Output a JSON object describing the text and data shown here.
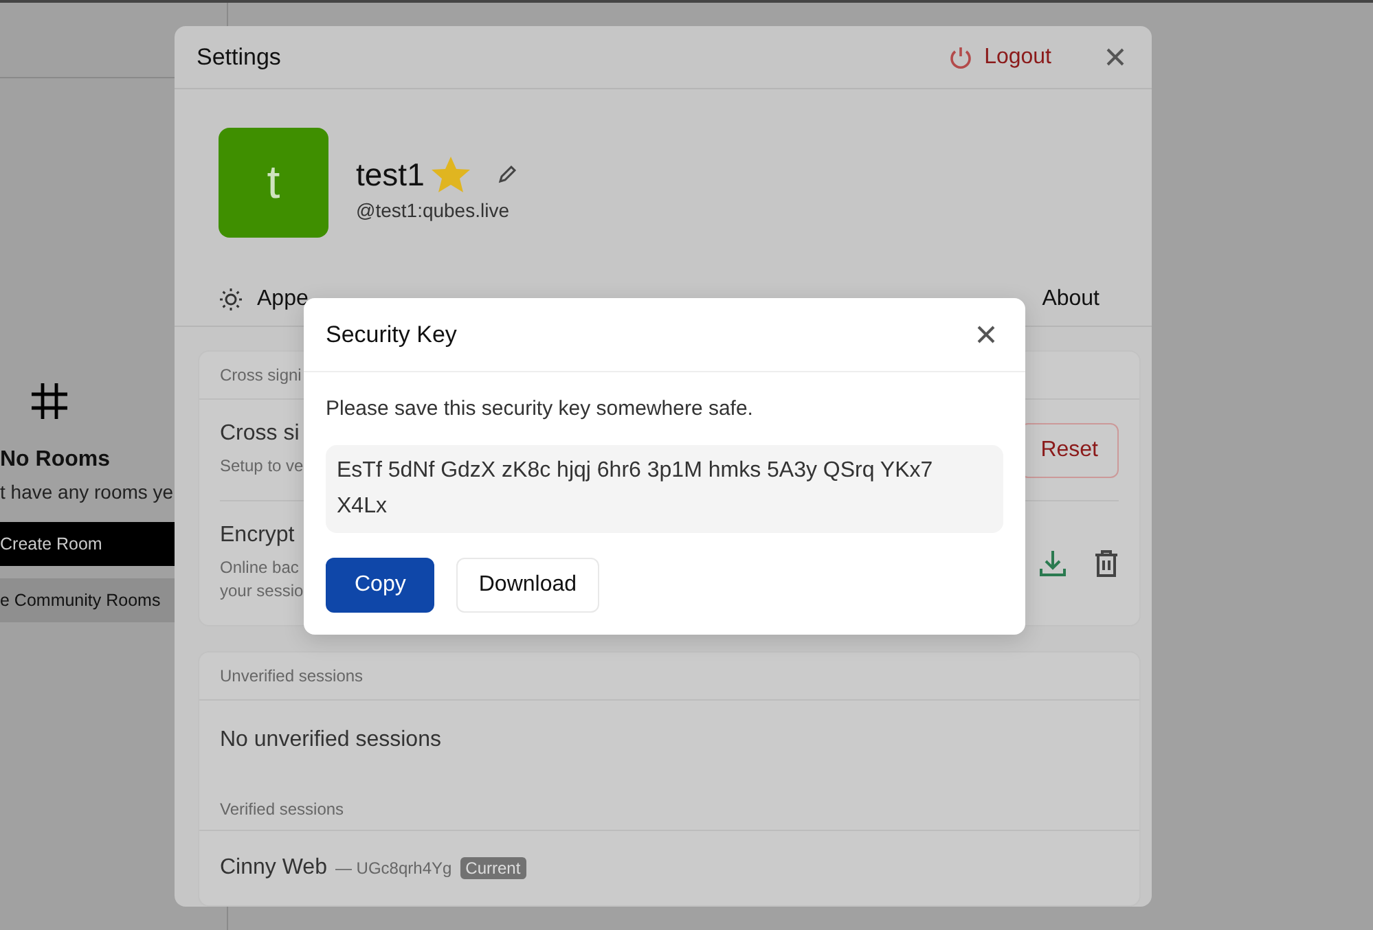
{
  "sidebar": {
    "title": "No Rooms",
    "message": "t have any rooms ye",
    "buttons": [
      {
        "label": "Create Room",
        "kind": "primary"
      },
      {
        "label": "e Community Rooms",
        "kind": "secondary"
      }
    ]
  },
  "settings": {
    "title": "Settings",
    "logout": "Logout",
    "profile": {
      "avatar_letter": "t",
      "name": "test1",
      "user_id": "@test1:qubes.live"
    },
    "tabs": [
      {
        "label": "Appe",
        "kind": "with-icon"
      },
      {
        "label": "About",
        "kind": "plain"
      }
    ],
    "cross_signing": {
      "header": "Cross signi",
      "rows": [
        {
          "kind": "reset",
          "title": "Cross si",
          "description": [
            "Setup to ve"
          ],
          "action": "Reset"
        },
        {
          "kind": "backup",
          "title": "Encrypt",
          "description": [
            "Online bac",
            "your sessio"
          ]
        }
      ]
    },
    "sessions": {
      "unverified_header": "Unverified sessions",
      "unverified_empty": "No unverified sessions",
      "verified_header": "Verified sessions",
      "verified": [
        {
          "name": "Cinny Web",
          "id": "— UGc8qrh4Yg",
          "badge": "Current"
        }
      ]
    }
  },
  "security_key_dialog": {
    "title": "Security Key",
    "message": "Please save this security key somewhere safe.",
    "key": "EsTf 5dNf GdzX zK8c hjqj 6hr6 3p1M hmks 5A3y QSrq YKx7 X4Lx",
    "buttons": [
      {
        "label": "Copy",
        "kind": "primary"
      },
      {
        "label": "Download",
        "kind": "secondary"
      }
    ]
  }
}
